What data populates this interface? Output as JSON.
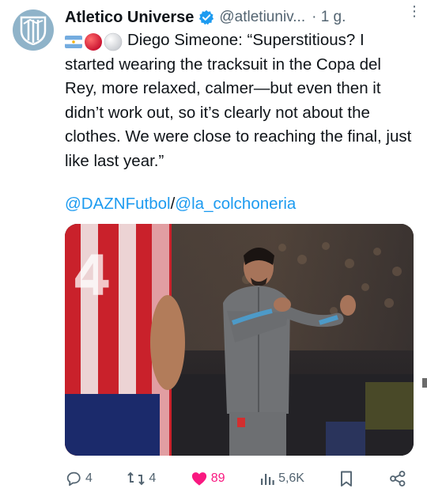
{
  "tweet": {
    "author_name": "Atletico Universe",
    "handle": "@atletiuniv...",
    "time": "· 1 g.",
    "more_label": "⋮",
    "emojis": [
      "argentina-flag",
      "red-circle",
      "white-circle"
    ],
    "text": "Diego Simeone: “Superstitious? I started wearing the tracksuit in the Copa del Rey, more relaxed, calmer—but even then it didn’t work out, so it’s clearly not about the clothes. We were close to reaching the final, just like last year.”",
    "mention_1": "@DAZNFutbol",
    "mention_sep": "/",
    "mention_2": "@la_colchoneria"
  },
  "actions": {
    "replies": "4",
    "retweets": "4",
    "likes": "89",
    "views": "5,6K"
  },
  "colors": {
    "link": "#1d9bf0",
    "like": "#f91880",
    "verified": "#1d9bf0",
    "secondary": "#536471"
  }
}
